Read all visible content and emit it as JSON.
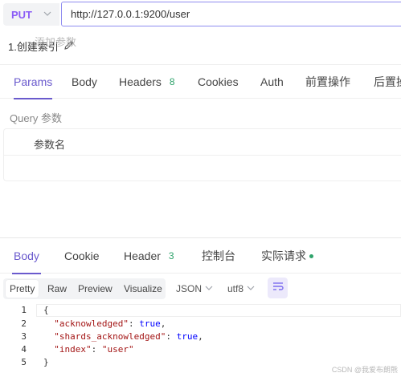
{
  "url_bar": {
    "method": "PUT",
    "url": "http://127.0.0.1:9200/user"
  },
  "request": {
    "name": "1.创建索引"
  },
  "request_tabs": [
    {
      "label": "Params"
    },
    {
      "label": "Body"
    },
    {
      "label": "Headers",
      "count": "8"
    },
    {
      "label": "Cookies"
    },
    {
      "label": "Auth"
    },
    {
      "label": "前置操作"
    },
    {
      "label": "后置操作"
    }
  ],
  "query": {
    "label": "Query 参数",
    "column_header": "参数名",
    "add_placeholder": "添加参数"
  },
  "response_tabs": [
    {
      "label": "Body"
    },
    {
      "label": "Cookie"
    },
    {
      "label": "Header",
      "count": "3"
    },
    {
      "label": "控制台"
    },
    {
      "label": "实际请求"
    }
  ],
  "format": {
    "modes": [
      "Pretty",
      "Raw",
      "Preview",
      "Visualize"
    ],
    "type": "JSON",
    "encoding": "utf8"
  },
  "code": {
    "line_numbers": [
      "1",
      "2",
      "3",
      "4",
      "5"
    ],
    "lines": [
      "{",
      "  \"acknowledged\": true,",
      "  \"shards_acknowledged\": true,",
      "  \"index\": \"user\"",
      "}"
    ]
  },
  "watermark": "CSDN @我爱布朗熊",
  "colors": {
    "accent": "#6a5acd",
    "method": "#8b5cf6",
    "count": "#2fa36b"
  }
}
